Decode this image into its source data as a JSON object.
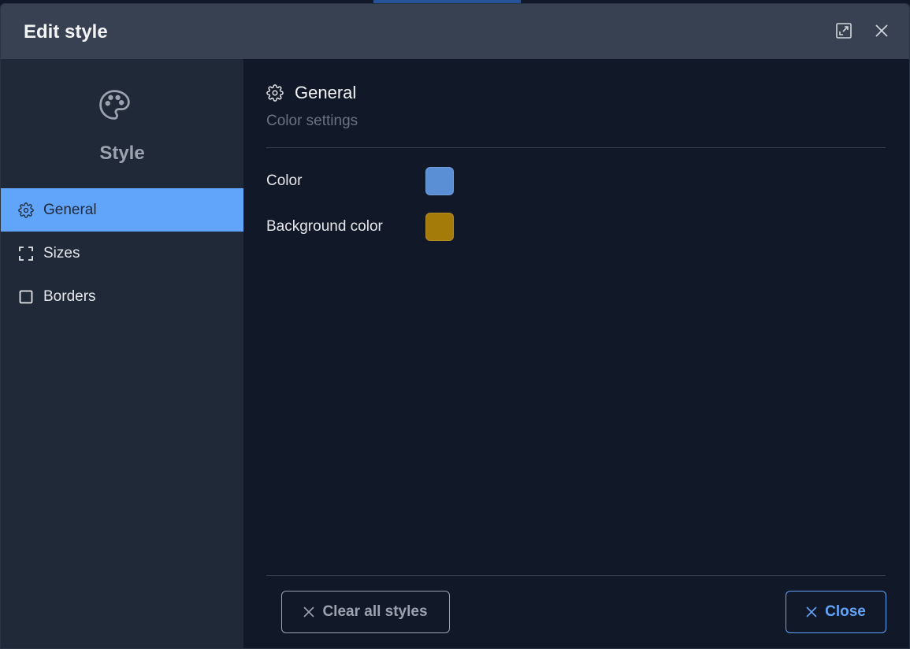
{
  "dialog": {
    "title": "Edit style",
    "maximize_icon": "maximize-icon",
    "close_icon": "close-icon"
  },
  "sidebar": {
    "header_icon": "palette-icon",
    "header_title": "Style",
    "items": [
      {
        "label": "General",
        "icon": "gear-icon",
        "active": true
      },
      {
        "label": "Sizes",
        "icon": "expand-corners-icon",
        "active": false
      },
      {
        "label": "Borders",
        "icon": "square-icon",
        "active": false
      }
    ]
  },
  "section": {
    "icon": "gear-icon",
    "title": "General",
    "subtitle": "Color settings"
  },
  "fields": [
    {
      "label": "Color",
      "value": "#5a8fd6"
    },
    {
      "label": "Background color",
      "value": "#a47a08"
    }
  ],
  "footer": {
    "clear_label": "Clear all styles",
    "close_label": "Close"
  },
  "colors": {
    "accent": "#60a5fa",
    "titlebar": "#374151",
    "sidebar": "#1f2937",
    "content": "#111827"
  }
}
